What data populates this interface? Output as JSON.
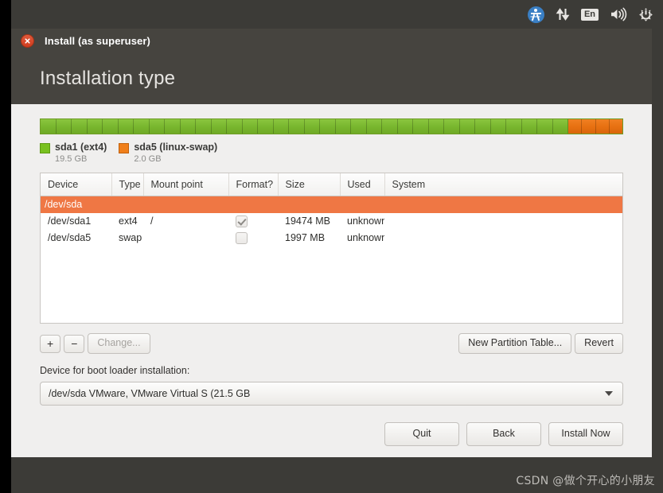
{
  "system_tray": {
    "items": [
      {
        "name": "accessibility-icon",
        "label": ""
      },
      {
        "name": "network-icon",
        "label": ""
      },
      {
        "name": "keyboard-layout-indicator",
        "label": "En"
      },
      {
        "name": "volume-icon",
        "label": ""
      },
      {
        "name": "power-icon",
        "label": ""
      }
    ]
  },
  "window": {
    "title": "Install (as superuser)",
    "page_title": "Installation type"
  },
  "partition_bar": {
    "segments": [
      {
        "name": "sda1",
        "color": "#79b72f",
        "percent": 90.7,
        "ticks": 34
      },
      {
        "name": "sda5",
        "color": "#e87112",
        "percent": 9.3,
        "ticks": 4
      }
    ]
  },
  "legend": [
    {
      "label": "sda1 (ext4)",
      "size": "19.5 GB",
      "color": "#79c11f"
    },
    {
      "label": "sda5 (linux-swap)",
      "size": "2.0 GB",
      "color": "#f07f1a"
    }
  ],
  "table": {
    "columns": [
      "Device",
      "Type",
      "Mount point",
      "Format?",
      "Size",
      "Used",
      "System"
    ],
    "rows": [
      {
        "kind": "disk",
        "device": "/dev/sda",
        "type": "",
        "mount_point": "",
        "format": null,
        "size": "",
        "used": "",
        "system": ""
      },
      {
        "kind": "partition",
        "device": "/dev/sda1",
        "type": "ext4",
        "mount_point": "/",
        "format": true,
        "size": "19474 MB",
        "used": "unknown",
        "system": ""
      },
      {
        "kind": "partition",
        "device": "/dev/sda5",
        "type": "swap",
        "mount_point": "",
        "format": false,
        "size": "1997 MB",
        "used": "unknown",
        "system": ""
      }
    ]
  },
  "toolbar": {
    "add_label": "+",
    "remove_label": "−",
    "change_label": "Change...",
    "new_partition_table_label": "New Partition Table...",
    "revert_label": "Revert"
  },
  "boot_loader": {
    "label": "Device for boot loader installation:",
    "selected": "/dev/sda   VMware, VMware Virtual S (21.5 GB"
  },
  "actions": {
    "quit_label": "Quit",
    "back_label": "Back",
    "install_label": "Install Now"
  },
  "watermark": "CSDN @做个开心的小朋友"
}
